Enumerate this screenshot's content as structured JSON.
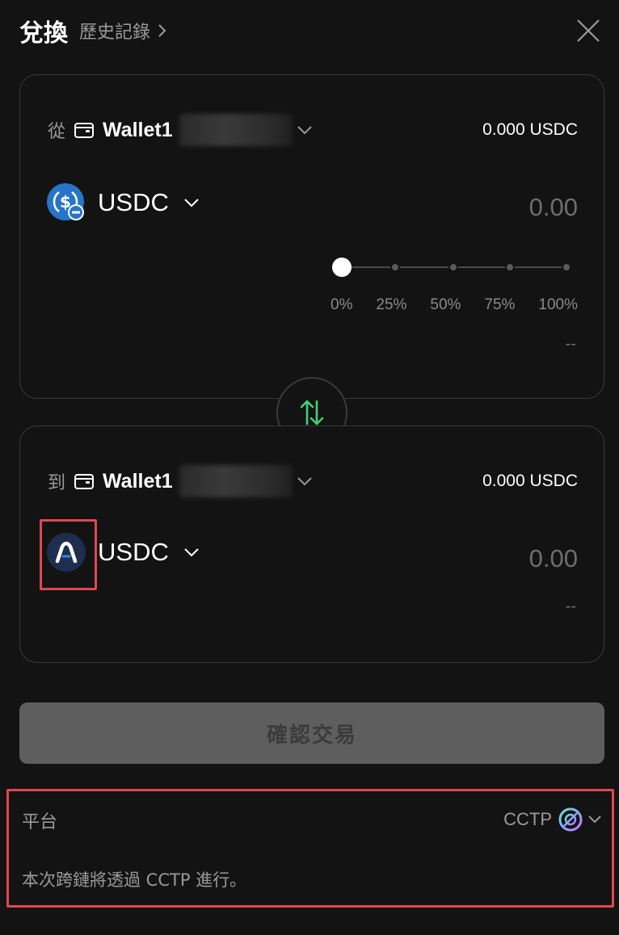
{
  "header": {
    "title": "兌換",
    "history_label": "歷史記錄"
  },
  "from": {
    "prefix": "從",
    "wallet_name": "Wallet1",
    "balance": "0.000 USDC",
    "token": "USDC",
    "amount": "0.00",
    "slider": {
      "value_percent": 0,
      "options": [
        "0%",
        "25%",
        "50%",
        "75%",
        "100%"
      ]
    },
    "fiat_value": "--"
  },
  "to": {
    "prefix": "到",
    "wallet_name": "Wallet1",
    "balance": "0.000 USDC",
    "token": "USDC",
    "amount": "0.00",
    "fiat_value": "--"
  },
  "confirm_label": "確認交易",
  "platform": {
    "label": "平台",
    "value": "CCTP",
    "note": "本次跨鏈將透過 CCTP 進行。"
  },
  "colors": {
    "background": "#131313",
    "card_border": "#3a3a3a",
    "swap_arrow": "#3fd07a",
    "usdc_blue": "#2775ca",
    "highlight": "#e0474f",
    "button_disabled": "#5e5e5e"
  },
  "icons": {
    "close": "close-icon",
    "wallet": "wallet-icon",
    "swap": "swap-arrows-icon",
    "cctp": "cctp-icon",
    "usdc": "usdc-icon",
    "arbitrum_usdc": "chain-token-icon"
  }
}
